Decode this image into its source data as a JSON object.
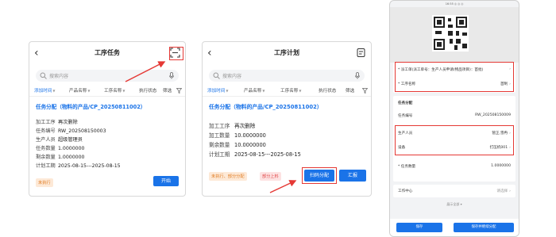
{
  "colors": {
    "accent": "#1a73e8",
    "highlight": "#e53935",
    "tag_orange": "#e07a1f",
    "tag_red": "#e04848"
  },
  "panel1": {
    "title": "工序任务",
    "action_icon": "scan-icon",
    "search_placeholder": "搜索内容",
    "filters": [
      "添加时间",
      "产品名称",
      "工序名称",
      "执行状态",
      "筛选"
    ],
    "card_title": "任务分配（物料的产品/CP_20250811002）",
    "fields": [
      {
        "k": "加工工序",
        "v": "再次删除"
      },
      {
        "k": "任务编号",
        "v": "RW_202508150003"
      },
      {
        "k": "生产人员",
        "v": "超级管理员"
      },
      {
        "k": "任务数量",
        "v": "1.0000000"
      },
      {
        "k": "剩余数量",
        "v": "1.0000000"
      },
      {
        "k": "计划工期",
        "v": "2025-08-15---2025-08-15"
      }
    ],
    "status_tag": "未执行",
    "start_button": "开始"
  },
  "panel2": {
    "title": "工序计划",
    "action_icon": "report-icon",
    "search_placeholder": "搜索内容",
    "filters": [
      "添加时间",
      "产品名称",
      "工序名称",
      "执行状态",
      "筛选"
    ],
    "card_title": "任务分配（物料的产品/CP_20250811002）",
    "fields": [
      {
        "k": "加工工序",
        "v": "再次删除"
      },
      {
        "k": "加工数量",
        "v": "10.0000000"
      },
      {
        "k": "剩余数量",
        "v": "10.0000000"
      },
      {
        "k": "计划工期",
        "v": "2025-08-15---2025-08-15"
      }
    ],
    "tags": [
      "未执行、部分分配",
      "部分上料"
    ],
    "scan_assign_button": "扫码分配",
    "report_button": "汇报"
  },
  "panel3": {
    "status_bar": "16:55 ◎ ◎ ◎",
    "rows_top": [
      {
        "label": "* 派工单(派工单号：生产人员申请(物品项目)：首批)",
        "value": ""
      },
      {
        "label": "* 工序名称",
        "value": "首制"
      }
    ],
    "section_title": "任务分配",
    "task_no_label": "任务编号",
    "task_no_value": "RW_202508150009",
    "staff_label": "生产人员",
    "staff_value": "管正,雪冉",
    "device_label": "设备",
    "device_value": "打压机001",
    "qty_label": "* 任务数量",
    "qty_value": "1.0000000",
    "work_center_label": "工作中心",
    "work_center_value": "请选择",
    "more_text": "展示全部 ▾",
    "save_button": "保存",
    "save_continue_button": "保存并继续分配"
  }
}
